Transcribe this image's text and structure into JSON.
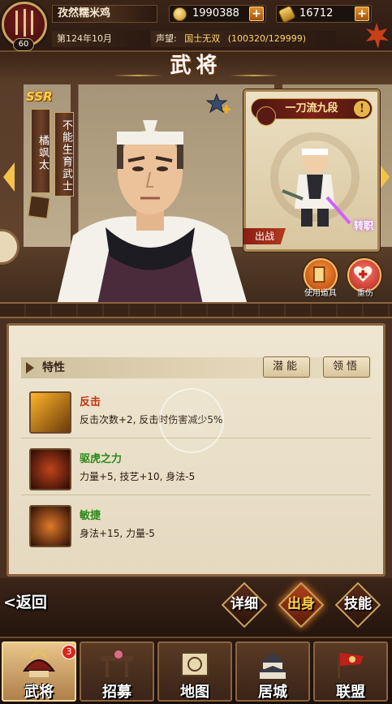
{
  "player": {
    "name": "孜然糯米鸡",
    "level": "60",
    "gold": "1990388",
    "ryo": "16712",
    "date": "第124年10月",
    "fame_label": "声望:",
    "fame_rank": "国士无双",
    "fame_value": "(100320/129999)"
  },
  "page": {
    "title": "武将"
  },
  "character": {
    "rarity": "SSR",
    "name": "橘飒太",
    "title": "不能生育武士"
  },
  "card": {
    "name": "一刀流九段",
    "excl": "!",
    "sortie": "出战",
    "convert": "转职"
  },
  "actions": {
    "use_item": "使用道具",
    "heal": "重伤"
  },
  "traits": {
    "header": "特性",
    "btn_potential": "潜能",
    "btn_comprehend": "领悟",
    "items": [
      {
        "name": "反击",
        "desc": "反击次数+2, 反击时伤害减少5%"
      },
      {
        "name": "驱虎之力",
        "desc": "力量+5, 技艺+10, 身法-5"
      },
      {
        "name": "敏捷",
        "desc": "身法+15, 力量-5"
      }
    ]
  },
  "bottom_actions": {
    "back": "<返回",
    "detail": "详细",
    "origin": "出身",
    "skill": "技能"
  },
  "nav": {
    "items": [
      {
        "label": "武将",
        "badge": "3"
      },
      {
        "label": "招募"
      },
      {
        "label": "地图"
      },
      {
        "label": "居城"
      },
      {
        "label": "联盟"
      }
    ]
  }
}
